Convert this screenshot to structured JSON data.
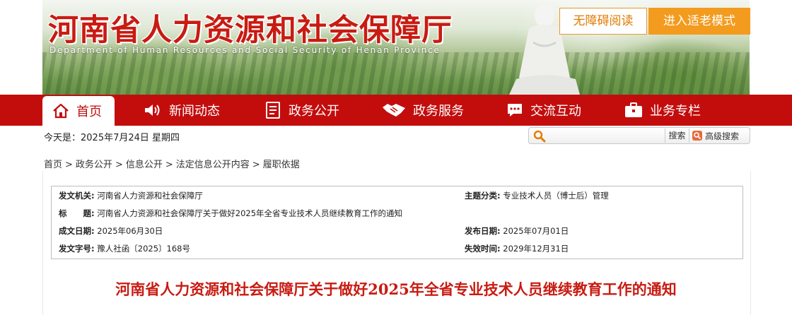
{
  "header": {
    "site_title": "河南省人力资源和社会保障厅",
    "site_subtitle": "Department of Human Resources and Social Security of Henan Province",
    "accessibility_label": "无障碍阅读",
    "elder_mode_label": "进入适老模式"
  },
  "nav": {
    "items": [
      {
        "label": "首页",
        "icon": "home-icon"
      },
      {
        "label": "新闻动态",
        "icon": "speaker-icon"
      },
      {
        "label": "政务公开",
        "icon": "document-icon"
      },
      {
        "label": "政务服务",
        "icon": "handshake-icon"
      },
      {
        "label": "交流互动",
        "icon": "chat-icon"
      },
      {
        "label": "业务专栏",
        "icon": "briefcase-icon"
      }
    ]
  },
  "date_line": "今天是：2025年7月24日 星期四",
  "search": {
    "placeholder": "",
    "button_label": "搜索",
    "advanced_label": "高级搜索"
  },
  "breadcrumb": [
    "首页",
    "政务公开",
    "信息公开",
    "法定信息公开内容",
    "履职依据"
  ],
  "meta": {
    "issuer_label": "发文机关:",
    "issuer": "河南省人力资源和社会保障厅",
    "topic_label": "主题分类:",
    "topic": "专业技术人员（博士后）管理",
    "title_label": "标　　题:",
    "title": "河南省人力资源和社会保障厅关于做好2025年全省专业技术人员继续教育工作的通知",
    "created_label": "成文日期:",
    "created": "2025年06月30日",
    "published_label": "发布日期:",
    "published": "2025年07月01日",
    "doc_no_label": "发文字号:",
    "doc_no": "豫人社函〔2025〕168号",
    "expiry_label": "失效时间:",
    "expiry": "2029年12月31日"
  },
  "document": {
    "title": "河南省人力资源和社会保障厅关于做好2025年全省专业技术人员继续教育工作的通知"
  },
  "colors": {
    "brand_red": "#c30d0d",
    "title_red": "#c81b12",
    "accent_orange": "#f39b1e"
  }
}
